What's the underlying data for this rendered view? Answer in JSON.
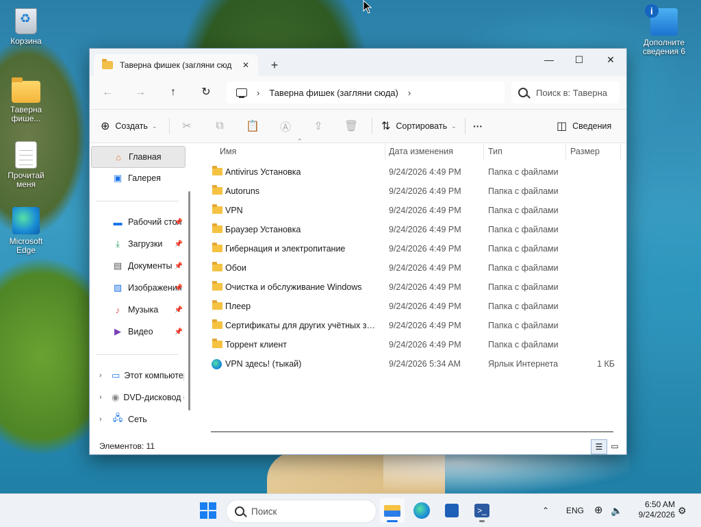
{
  "desktop": {
    "icons": [
      {
        "label": "Корзина",
        "icon": "recycle-bin-icon"
      },
      {
        "label": "Таверна фише...",
        "icon": "folder-icon"
      },
      {
        "label": "Прочитай меня",
        "icon": "text-document-icon"
      },
      {
        "label": "Microsoft Edge",
        "icon": "edge-icon"
      },
      {
        "label": "Дополните сведения 6",
        "icon": "info-shortcut-icon"
      }
    ]
  },
  "window": {
    "tab_title": "Таверна фишек (загляни сюд",
    "tab_close": "✕",
    "new_tab": "+",
    "minimize": "—",
    "maximize": "☐",
    "close": "✕",
    "address": "Таверна фишек (загляни сюда)",
    "search_placeholder": "Поиск в: Таверна",
    "toolbar": {
      "create_label": "Создать",
      "sort_label": "Сортировать",
      "more_label": "···",
      "details_label": "Сведения"
    },
    "nav": {
      "items": [
        {
          "label": "Главная",
          "icon": "home-icon"
        },
        {
          "label": "Галерея",
          "icon": "gallery-icon"
        },
        {
          "label": "Рабочий стол",
          "icon": "desktop-icon"
        },
        {
          "label": "Загрузки",
          "icon": "downloads-icon"
        },
        {
          "label": "Документы",
          "icon": "documents-icon"
        },
        {
          "label": "Изображения",
          "icon": "pictures-icon"
        },
        {
          "label": "Музыка",
          "icon": "music-icon"
        },
        {
          "label": "Видео",
          "icon": "video-icon"
        },
        {
          "label": "Этот компьютер",
          "icon": "this-pc-icon"
        },
        {
          "label": "DVD-дисковод (",
          "icon": "dvd-icon"
        },
        {
          "label": "Сеть",
          "icon": "network-icon"
        }
      ]
    },
    "columns": [
      "Имя",
      "Дата изменения",
      "Тип",
      "Размер"
    ],
    "files": [
      {
        "name": "Antivirus Установка",
        "date": "9/24/2026 4:49 PM",
        "type": "Папка с файлами",
        "size": ""
      },
      {
        "name": "Autoruns",
        "date": "9/24/2026 4:49 PM",
        "type": "Папка с файлами",
        "size": ""
      },
      {
        "name": "VPN",
        "date": "9/24/2026 4:49 PM",
        "type": "Папка с файлами",
        "size": ""
      },
      {
        "name": "Браузер Установка",
        "date": "9/24/2026 4:49 PM",
        "type": "Папка с файлами",
        "size": ""
      },
      {
        "name": "Гибернация и электропитание",
        "date": "9/24/2026 4:49 PM",
        "type": "Папка с файлами",
        "size": ""
      },
      {
        "name": "Обои",
        "date": "9/24/2026 4:49 PM",
        "type": "Папка с файлами",
        "size": ""
      },
      {
        "name": "Очистка и обслуживание Windows",
        "date": "9/24/2026 4:49 PM",
        "type": "Папка с файлами",
        "size": ""
      },
      {
        "name": "Плеер",
        "date": "9/24/2026 4:49 PM",
        "type": "Папка с файлами",
        "size": ""
      },
      {
        "name": "Сертификаты для других учётных запи...",
        "date": "9/24/2026 4:49 PM",
        "type": "Папка с файлами",
        "size": ""
      },
      {
        "name": "Торрент клиент",
        "date": "9/24/2026 4:49 PM",
        "type": "Папка с файлами",
        "size": ""
      },
      {
        "name": "VPN здесь! (тыкай)",
        "date": "9/24/2026 5:34 AM",
        "type": "Ярлык Интернета",
        "size": "1 КБ"
      }
    ],
    "status": "Элементов: 11"
  },
  "taskbar": {
    "search_placeholder": "Поиск",
    "language": "ENG",
    "time": "6:50 AM",
    "date": "9/24/2026"
  },
  "colors": {
    "accent": "#1a73e8",
    "folder": "#f5c242",
    "window_border": "#7a9ab8"
  }
}
